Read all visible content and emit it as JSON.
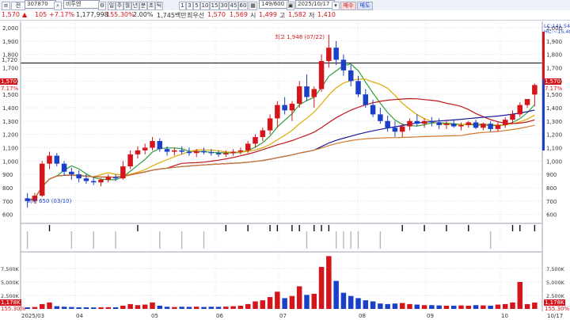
{
  "toolbar": {
    "code": "307870",
    "name": "비투엔",
    "periods": [
      "일",
      "주",
      "월",
      "년",
      "분",
      "초",
      "틱"
    ],
    "minutes": [
      "1",
      "3",
      "5",
      "10",
      "15",
      "30",
      "45",
      "60"
    ],
    "count": "149/600",
    "date": "2025/10/17",
    "buy_label": "매수",
    "sell_label": "매도"
  },
  "quote": {
    "price": "1,570",
    "change": "105",
    "change_pct": "+7.17%",
    "volume": "1,177,998",
    "volume_ratio": "155.30%",
    "turnover": "2.00%",
    "amount": "1,745백만",
    "priority": "최우선",
    "current": "1,570",
    "prev": "1,569",
    "open_label": "시",
    "open": "1,499",
    "high_label": "고",
    "high": "1,582",
    "low_label": "저",
    "low": "1,410"
  },
  "right_labels": {
    "lc": "LC:141.54",
    "hc": "HC:~15.40"
  },
  "price_axis": [
    "2,000",
    "1,900",
    "1,800",
    "1,700",
    "1,600",
    "1,500",
    "1,400",
    "1,300",
    "1,200",
    "1,100",
    "1,000",
    "900",
    "800",
    "700",
    "600"
  ],
  "volume_axis": [
    "7,500K",
    "5,000K",
    "2,500K"
  ],
  "x_axis": [
    "2025/03",
    "04",
    "05",
    "06",
    "07",
    "08",
    "09",
    "10",
    "10/17"
  ],
  "ref_line_label": "1,720",
  "high_annotation": "최고 1,948 (07/22)",
  "low_annotation": "최저 650 (03/10)",
  "price_tag": "1,570",
  "price_tag_pct": "7.17%",
  "volume_tag": "1,178K",
  "volume_tag_pct": "155.30%",
  "colors": {
    "up": "#d4161c",
    "down": "#1a40c8",
    "ma20": "#c0161f",
    "ma60": "#1a1a9c",
    "ma120": "#d2772a"
  },
  "chart_data": {
    "type": "candlestick",
    "ylim": [
      580,
      2000
    ],
    "ylabel": "",
    "reference_line": 1720,
    "ohlc": [
      [
        720,
        760,
        650,
        700
      ],
      [
        700,
        760,
        680,
        740
      ],
      [
        740,
        1000,
        730,
        980
      ],
      [
        980,
        1070,
        940,
        1040
      ],
      [
        1040,
        1060,
        960,
        980
      ],
      [
        980,
        1000,
        890,
        920
      ],
      [
        920,
        950,
        860,
        900
      ],
      [
        900,
        930,
        840,
        870
      ],
      [
        870,
        900,
        830,
        850
      ],
      [
        850,
        880,
        820,
        840
      ],
      [
        840,
        870,
        810,
        860
      ],
      [
        860,
        900,
        840,
        880
      ],
      [
        880,
        900,
        850,
        870
      ],
      [
        870,
        1000,
        860,
        960
      ],
      [
        960,
        1080,
        940,
        1050
      ],
      [
        1050,
        1110,
        1020,
        1080
      ],
      [
        1080,
        1130,
        1050,
        1100
      ],
      [
        1100,
        1180,
        1080,
        1150
      ],
      [
        1150,
        1170,
        1070,
        1090
      ],
      [
        1090,
        1110,
        1040,
        1070
      ],
      [
        1070,
        1100,
        1040,
        1080
      ],
      [
        1080,
        1110,
        1050,
        1070
      ],
      [
        1070,
        1100,
        1040,
        1060
      ],
      [
        1060,
        1090,
        1030,
        1075
      ],
      [
        1075,
        1100,
        1050,
        1065
      ],
      [
        1065,
        1090,
        1040,
        1060
      ],
      [
        1060,
        1080,
        1030,
        1050
      ],
      [
        1050,
        1080,
        1030,
        1060
      ],
      [
        1060,
        1090,
        1040,
        1070
      ],
      [
        1070,
        1100,
        1050,
        1080
      ],
      [
        1080,
        1150,
        1060,
        1130
      ],
      [
        1130,
        1200,
        1100,
        1180
      ],
      [
        1180,
        1250,
        1150,
        1230
      ],
      [
        1230,
        1350,
        1200,
        1320
      ],
      [
        1320,
        1450,
        1250,
        1420
      ],
      [
        1420,
        1480,
        1350,
        1380
      ],
      [
        1380,
        1450,
        1300,
        1430
      ],
      [
        1430,
        1600,
        1400,
        1560
      ],
      [
        1560,
        1650,
        1450,
        1480
      ],
      [
        1480,
        1560,
        1400,
        1540
      ],
      [
        1540,
        1800,
        1520,
        1750
      ],
      [
        1750,
        1948,
        1700,
        1850
      ],
      [
        1850,
        1900,
        1720,
        1760
      ],
      [
        1760,
        1800,
        1640,
        1680
      ],
      [
        1680,
        1720,
        1560,
        1600
      ],
      [
        1600,
        1640,
        1480,
        1500
      ],
      [
        1500,
        1540,
        1400,
        1420
      ],
      [
        1420,
        1460,
        1330,
        1350
      ],
      [
        1350,
        1400,
        1280,
        1300
      ],
      [
        1300,
        1340,
        1220,
        1250
      ],
      [
        1250,
        1300,
        1180,
        1220
      ],
      [
        1220,
        1280,
        1180,
        1260
      ],
      [
        1260,
        1320,
        1230,
        1300
      ],
      [
        1300,
        1350,
        1260,
        1280
      ],
      [
        1280,
        1320,
        1250,
        1300
      ],
      [
        1300,
        1330,
        1260,
        1290
      ],
      [
        1290,
        1320,
        1240,
        1270
      ],
      [
        1270,
        1310,
        1240,
        1280
      ],
      [
        1280,
        1310,
        1250,
        1260
      ],
      [
        1260,
        1290,
        1230,
        1270
      ],
      [
        1270,
        1300,
        1250,
        1290
      ],
      [
        1290,
        1310,
        1240,
        1250
      ],
      [
        1250,
        1290,
        1230,
        1280
      ],
      [
        1280,
        1300,
        1220,
        1240
      ],
      [
        1240,
        1290,
        1220,
        1270
      ],
      [
        1270,
        1330,
        1250,
        1310
      ],
      [
        1310,
        1380,
        1280,
        1350
      ],
      [
        1350,
        1440,
        1330,
        1420
      ],
      [
        1420,
        1460,
        1400,
        1465
      ],
      [
        1499,
        1582,
        1410,
        1570
      ]
    ],
    "volume": [
      300,
      350,
      900,
      1200,
      500,
      400,
      350,
      300,
      300,
      280,
      300,
      320,
      300,
      600,
      900,
      700,
      800,
      1200,
      600,
      400,
      350,
      400,
      380,
      420,
      360,
      400,
      380,
      420,
      500,
      600,
      900,
      1400,
      1600,
      2200,
      3200,
      2000,
      2400,
      4200,
      2600,
      2800,
      7800,
      9800,
      5200,
      3000,
      2400,
      2000,
      1600,
      1400,
      1000,
      900,
      1000,
      1100,
      900,
      800,
      700,
      700,
      650,
      600,
      600,
      650,
      600,
      700,
      650,
      600,
      800,
      900,
      1200,
      5000,
      900,
      1178
    ]
  }
}
